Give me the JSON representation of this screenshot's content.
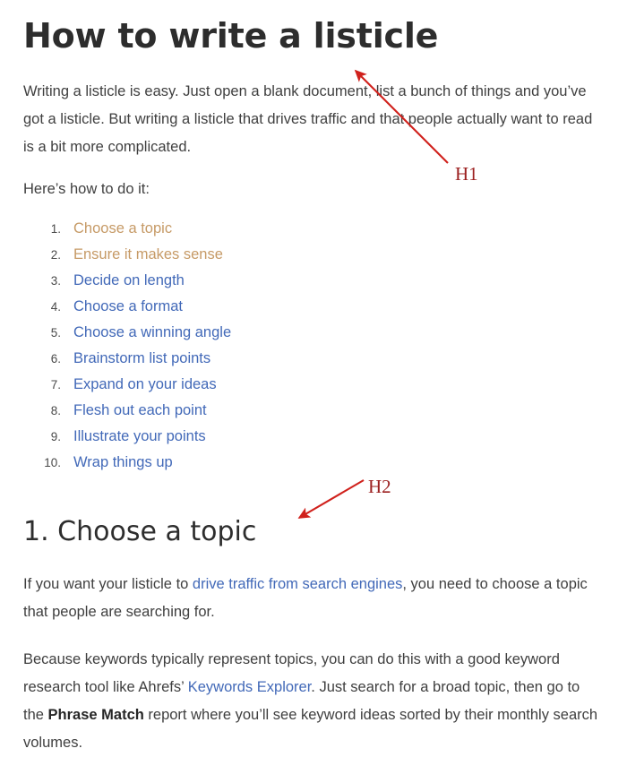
{
  "document": {
    "title": "How to write a listicle",
    "paragraphs": {
      "intro": "Writing a listicle is easy. Just open a blank document, list a bunch of things and you’ve got a listicle. But writing a listicle that drives traffic and that people actually want to read is a bit more complicated.",
      "lead_in": "Here’s how to do it:",
      "after_h2_part1": "If you want your listicle to ",
      "after_h2_link": "drive traffic from search engines",
      "after_h2_part2": ", you need to choose a topic that people are searching for.",
      "last_part1": "Because keywords typically represent topics, you can do this with a good keyword research tool like Ahrefs’ ",
      "last_link": "Keywords Explorer",
      "last_part2": ". Just search for a broad topic, then go to the ",
      "last_bold": "Phrase Match",
      "last_part3": " report where you’ll see keyword ideas sorted by their monthly search volumes."
    },
    "subtitle": "1. Choose a topic",
    "steps": [
      {
        "label": "Choose a topic",
        "state": "visited"
      },
      {
        "label": "Ensure it makes sense",
        "state": "visited"
      },
      {
        "label": "Decide on length",
        "state": "unvisited"
      },
      {
        "label": "Choose a format",
        "state": "unvisited"
      },
      {
        "label": "Choose a winning angle",
        "state": "unvisited"
      },
      {
        "label": "Brainstorm list points",
        "state": "unvisited"
      },
      {
        "label": "Expand on your ideas",
        "state": "unvisited"
      },
      {
        "label": "Flesh out each point",
        "state": "unvisited"
      },
      {
        "label": "Illustrate your points",
        "state": "unvisited"
      },
      {
        "label": "Wrap things up",
        "state": "unvisited"
      }
    ]
  },
  "annotations": {
    "h1": {
      "label": "H1"
    },
    "h2": {
      "label": "H2"
    }
  },
  "colors": {
    "background": "#ffffff",
    "heading": "#2d2d2d",
    "body_text": "#3f3f3f",
    "link": "#4269b8",
    "link_visited": "#c69a66",
    "annotation_red": "#d0211c",
    "annotation_label": "#9c2020",
    "list_number": "#4a4a4a"
  }
}
